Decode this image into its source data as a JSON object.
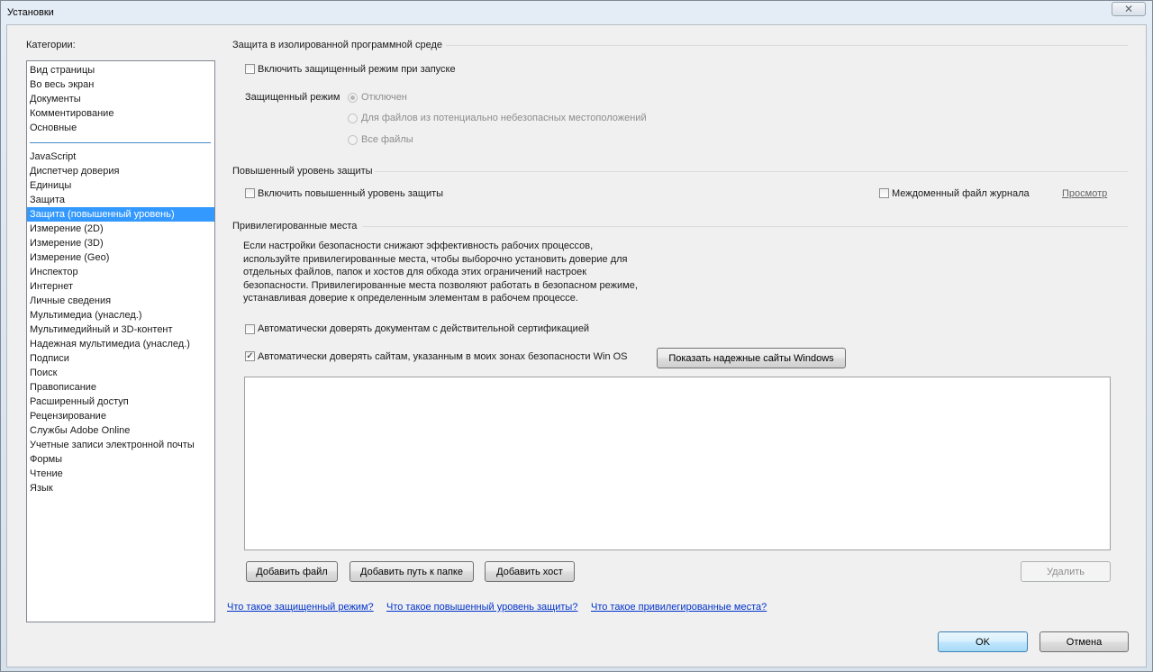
{
  "window": {
    "title": "Установки",
    "close_symbol": "✕"
  },
  "categories": {
    "label": "Категории:",
    "group1": [
      "Вид страницы",
      "Во весь экран",
      "Документы",
      "Комментирование",
      "Основные"
    ],
    "group2": [
      "JavaScript",
      "Диспетчер доверия",
      "Единицы",
      "Защита",
      "Защита (повышенный уровень)",
      "Измерение (2D)",
      "Измерение (3D)",
      "Измерение (Geo)",
      "Инспектор",
      "Интернет",
      "Личные сведения",
      "Мультимедиа (унаслед.)",
      "Мультимедийный и 3D-контент",
      "Надежная мультимедиа (унаслед.)",
      "Подписи",
      "Поиск",
      "Правописание",
      "Расширенный доступ",
      "Рецензирование",
      "Службы Adobe Online",
      "Учетные записи электронной почты",
      "Формы",
      "Чтение",
      "Язык"
    ],
    "selected": "Защита (повышенный уровень)"
  },
  "sandbox": {
    "title": "Защита в изолированной программной среде",
    "enable_label": "Включить защищенный режим при запуске",
    "enable_checked": false,
    "mode_label": "Защищенный режим",
    "options": [
      "Отключен",
      "Для файлов из потенциально небезопасных местоположений",
      "Все файлы"
    ],
    "selected_option": "Отключен"
  },
  "enhanced": {
    "title": "Повышенный уровень защиты",
    "enable_label": "Включить повышенный уровень защиты",
    "enable_checked": false,
    "log_label": "Междоменный файл журнала",
    "log_checked": false,
    "view_link": "Просмотр"
  },
  "privileged": {
    "title": "Привилегированные места",
    "description": "Если настройки безопасности снижают эффективность рабочих процессов, используйте привилегированные места, чтобы выборочно установить доверие для отдельных файлов, папок и хостов для обхода этих ограничений настроек безопасности. Привилегированные места позволяют работать в безопасном режиме, устанавливая доверие к определенным элементам в рабочем процессе.",
    "auto_cert_label": "Автоматически доверять документам с действительной сертификацией",
    "auto_cert_checked": false,
    "auto_sites_label": "Автоматически доверять сайтам, указанным в моих зонах безопасности Win OS",
    "auto_sites_checked": true,
    "show_sites_button": "Показать надежные сайты Windows",
    "add_file": "Добавить файл",
    "add_folder": "Добавить путь к папке",
    "add_host": "Добавить хост",
    "remove": "Удалить"
  },
  "help_links": [
    "Что такое защищенный режим?",
    "Что такое повышенный уровень защиты?",
    "Что такое привилегированные места?"
  ],
  "footer": {
    "ok": "OK",
    "cancel": "Отмена"
  },
  "check_mark": "✓"
}
